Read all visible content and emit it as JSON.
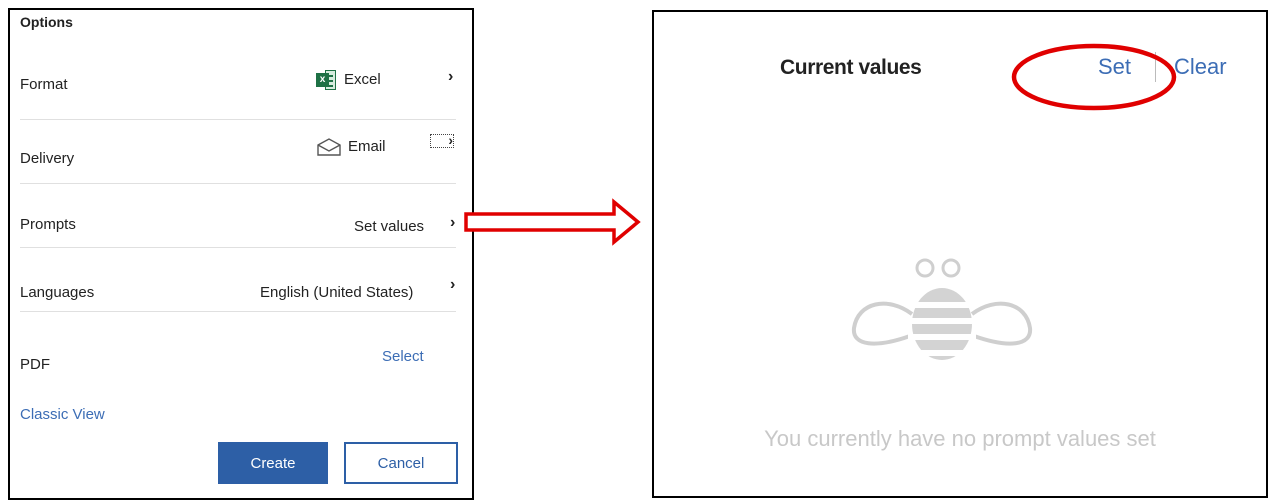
{
  "options_panel": {
    "title": "Options",
    "rows": [
      {
        "label": "Format",
        "value": "Excel",
        "icon": "excel-icon"
      },
      {
        "label": "Delivery",
        "value": "Email",
        "icon": "envelope-icon"
      },
      {
        "label": "Prompts",
        "value": "Set values"
      },
      {
        "label": "Languages",
        "value": "English (United States)"
      },
      {
        "label": "PDF",
        "value": "Select"
      }
    ],
    "classic_view": "Classic View",
    "create_label": "Create",
    "cancel_label": "Cancel"
  },
  "prompt_panel": {
    "title": "Current values",
    "set_label": "Set",
    "clear_label": "Clear",
    "empty_message": "You currently have no prompt values set"
  },
  "colors": {
    "link": "#3c6db5",
    "primary_button": "#2d5fa6",
    "annotation": "#e00000"
  }
}
